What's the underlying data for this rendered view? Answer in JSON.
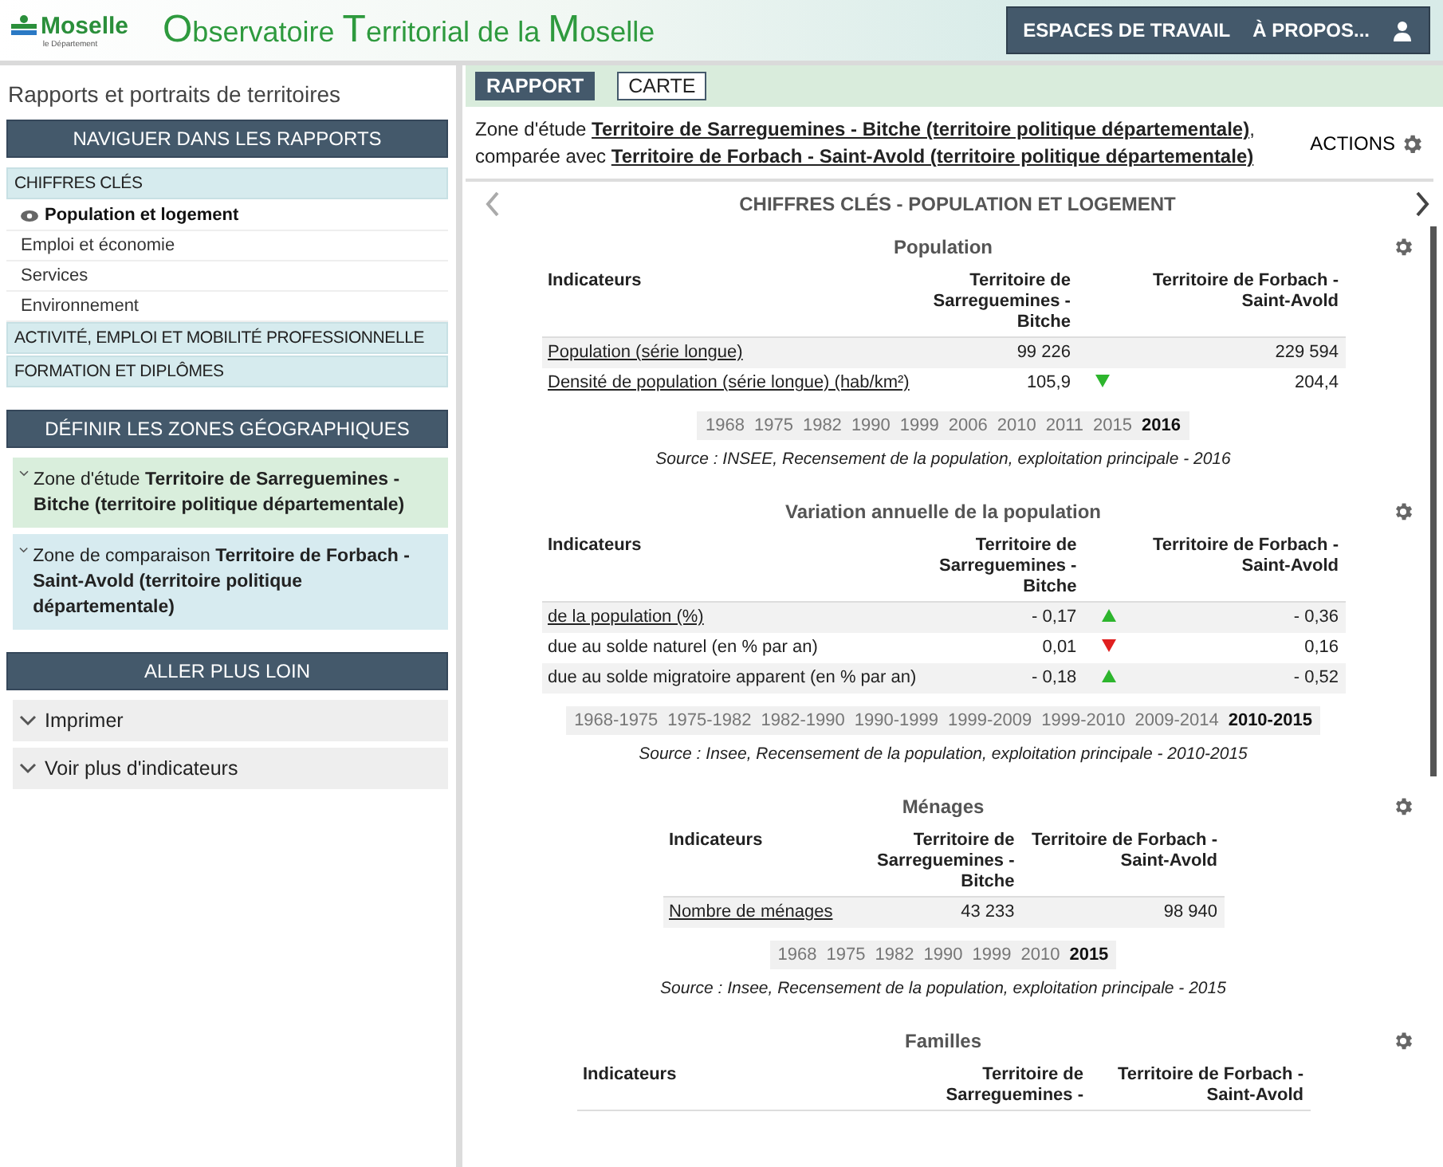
{
  "header": {
    "logo": {
      "name": "Moselle",
      "subtitle": "le Département"
    },
    "title": "Observatoire Territorial de la Moselle",
    "menu": [
      "ESPACES DE TRAVAIL",
      "À PROPOS..."
    ]
  },
  "sidebar": {
    "title": "Rapports et portraits de territoires",
    "navigate": {
      "heading": "NAVIGUER DANS LES RAPPORTS",
      "categories": [
        {
          "label": "CHIFFRES CLÉS",
          "children": [
            {
              "label": "Population et logement",
              "selected": true
            },
            {
              "label": "Emploi et économie",
              "selected": false
            },
            {
              "label": "Services",
              "selected": false
            },
            {
              "label": "Environnement",
              "selected": false
            }
          ]
        },
        {
          "label": "ACTIVITÉ, EMPLOI ET MOBILITÉ PROFESSIONNELLE"
        },
        {
          "label": "FORMATION ET DIPLÔMES"
        }
      ]
    },
    "zones": {
      "heading": "DÉFINIR LES ZONES GÉOGRAPHIQUES",
      "items": [
        {
          "text": "Zone d'étude **Territoire de Sarreguemines - Bitche (territoire politique départementale)**",
          "color": "#d9eedc"
        },
        {
          "text": "Zone de comparaison **Territoire de Forbach - Saint-Avold (territoire politique départementale)**",
          "color": "#d7ebf0"
        }
      ]
    },
    "more": {
      "heading": "ALLER PLUS LOIN",
      "items": [
        "Imprimer",
        "Voir plus d'indicateurs"
      ]
    }
  },
  "main": {
    "tabs": [
      {
        "label": "RAPPORT",
        "selected": true
      },
      {
        "label": "CARTE",
        "selected": false
      }
    ],
    "zone_text": {
      "prefix": "Zone d'étude",
      "study": "Territoire de Sarreguemines - Bitche (territoire politique départementale)",
      "middle": ", comparée avec",
      "comparison": "Territoire de Forbach - Saint-Avold (territoire politique départementale)"
    },
    "actions": "ACTIONS",
    "report_title": "CHIFFRES CLÉS - POPULATION ET LOGEMENT",
    "sections": [
      {
        "title": "Population",
        "columns": [
          "Indicateurs",
          "Territoire de Sarreguemines - Bitche",
          "Territoire de Forbach - Saint-Avold"
        ],
        "rows": [
          {
            "label": "Population (série longue)",
            "link": true,
            "value_1": "99 226",
            "value_2": "229 594"
          },
          {
            "label": "Densité de population (série longue) (hab/km²)",
            "link": true,
            "value_1": "105,9",
            "rising": false,
            "color": "#2db52d",
            "value_2": "204,4"
          }
        ],
        "years": [
          {
            "label": "1968",
            "selected": false
          },
          {
            "label": "1975",
            "selected": false
          },
          {
            "label": "1982",
            "selected": false
          },
          {
            "label": "1990",
            "selected": false
          },
          {
            "label": "1999",
            "selected": false
          },
          {
            "label": "2006",
            "selected": false
          },
          {
            "label": "2010",
            "selected": false
          },
          {
            "label": "2011",
            "selected": false
          },
          {
            "label": "2015",
            "selected": false
          },
          {
            "label": "2016",
            "selected": true
          }
        ],
        "source": "Source : INSEE, Recensement de la population, exploitation principale - 2016"
      },
      {
        "title": "Variation annuelle de la population",
        "columns": [
          "Indicateurs",
          "Territoire de Sarreguemines - Bitche",
          "Territoire de Forbach - Saint-Avold"
        ],
        "rows": [
          {
            "label": "de la population (%)",
            "link": true,
            "value_1": "- 0,17",
            "rising": true,
            "color": "#2db52d",
            "value_2": "- 0,36"
          },
          {
            "label": "due au solde naturel (en % par an)",
            "link": false,
            "value_1": "0,01",
            "rising": false,
            "color": "#e02020",
            "value_2": "0,16"
          },
          {
            "label": "due au solde migratoire apparent (en % par an)",
            "link": false,
            "value_1": "- 0,18",
            "rising": true,
            "color": "#2db52d",
            "value_2": "- 0,52"
          }
        ],
        "years": [
          {
            "label": "1968-1975",
            "selected": false
          },
          {
            "label": "1975-1982",
            "selected": false
          },
          {
            "label": "1982-1990",
            "selected": false
          },
          {
            "label": "1990-1999",
            "selected": false
          },
          {
            "label": "1999-2009",
            "selected": false
          },
          {
            "label": "1999-2010",
            "selected": false
          },
          {
            "label": "2009-2014",
            "selected": false
          },
          {
            "label": "2010-2015",
            "selected": true
          }
        ],
        "source": "Source : Insee, Recensement de la population, exploitation principale - 2010-2015"
      },
      {
        "title": "Ménages",
        "columns": [
          "Indicateurs",
          "Territoire de Sarreguemines - Bitche",
          "Territoire de Forbach - Saint-Avold"
        ],
        "rows": [
          {
            "label": "Nombre de ménages",
            "link": true,
            "value_1": "43 233",
            "value_2": "98 940"
          }
        ],
        "years": [
          {
            "label": "1968",
            "selected": false
          },
          {
            "label": "1975",
            "selected": false
          },
          {
            "label": "1982",
            "selected": false
          },
          {
            "label": "1990",
            "selected": false
          },
          {
            "label": "1999",
            "selected": false
          },
          {
            "label": "2010",
            "selected": false
          },
          {
            "label": "2015",
            "selected": true
          }
        ],
        "source": "Source : Insee, Recensement de la population, exploitation principale - 2015"
      },
      {
        "title": "Familles",
        "columns": [
          "Indicateurs",
          "Territoire de Sarreguemines -",
          "Territoire de Forbach - Saint-Avold"
        ]
      }
    ]
  }
}
